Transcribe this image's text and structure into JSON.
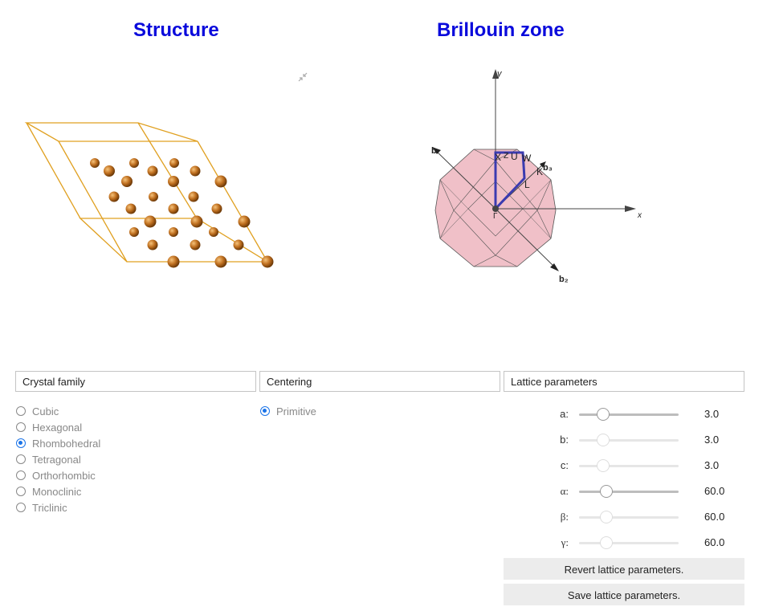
{
  "titles": {
    "structure": "Structure",
    "brillouin": "Brillouin zone"
  },
  "bz_labels": {
    "y": "y",
    "x": "x",
    "b1": "b",
    "b2": "b₂",
    "b3": "b₃",
    "X": "X",
    "U": "U",
    "W": "W",
    "K": "K",
    "L": "L",
    "Gamma": "Γ",
    "Z": "Z"
  },
  "crystal_family": {
    "header": "Crystal family",
    "options": [
      {
        "label": "Cubic",
        "checked": false
      },
      {
        "label": "Hexagonal",
        "checked": false
      },
      {
        "label": "Rhombohedral",
        "checked": true
      },
      {
        "label": "Tetragonal",
        "checked": false
      },
      {
        "label": "Orthorhombic",
        "checked": false
      },
      {
        "label": "Monoclinic",
        "checked": false
      },
      {
        "label": "Triclinic",
        "checked": false
      }
    ]
  },
  "centering": {
    "header": "Centering",
    "options": [
      {
        "label": "Primitive",
        "checked": true
      }
    ]
  },
  "lattice": {
    "header": "Lattice parameters",
    "params": [
      {
        "label": "a:",
        "value": "3.0",
        "enabled": true
      },
      {
        "label": "b:",
        "value": "3.0",
        "enabled": false
      },
      {
        "label": "c:",
        "value": "3.0",
        "enabled": false
      },
      {
        "label": "α:",
        "value": "60.0",
        "enabled": true
      },
      {
        "label": "β:",
        "value": "60.0",
        "enabled": false
      },
      {
        "label": "γ:",
        "value": "60.0",
        "enabled": false
      }
    ],
    "revert_label": "Revert lattice parameters.",
    "save_label": "Save lattice parameters."
  },
  "colors": {
    "title": "#0a0adc",
    "cell_edge": "#e0a020",
    "atom": "#c07020",
    "bz_fill": "#f0c0c8",
    "path": "#3b3bb0",
    "radio_accent": "#1a73e8"
  }
}
